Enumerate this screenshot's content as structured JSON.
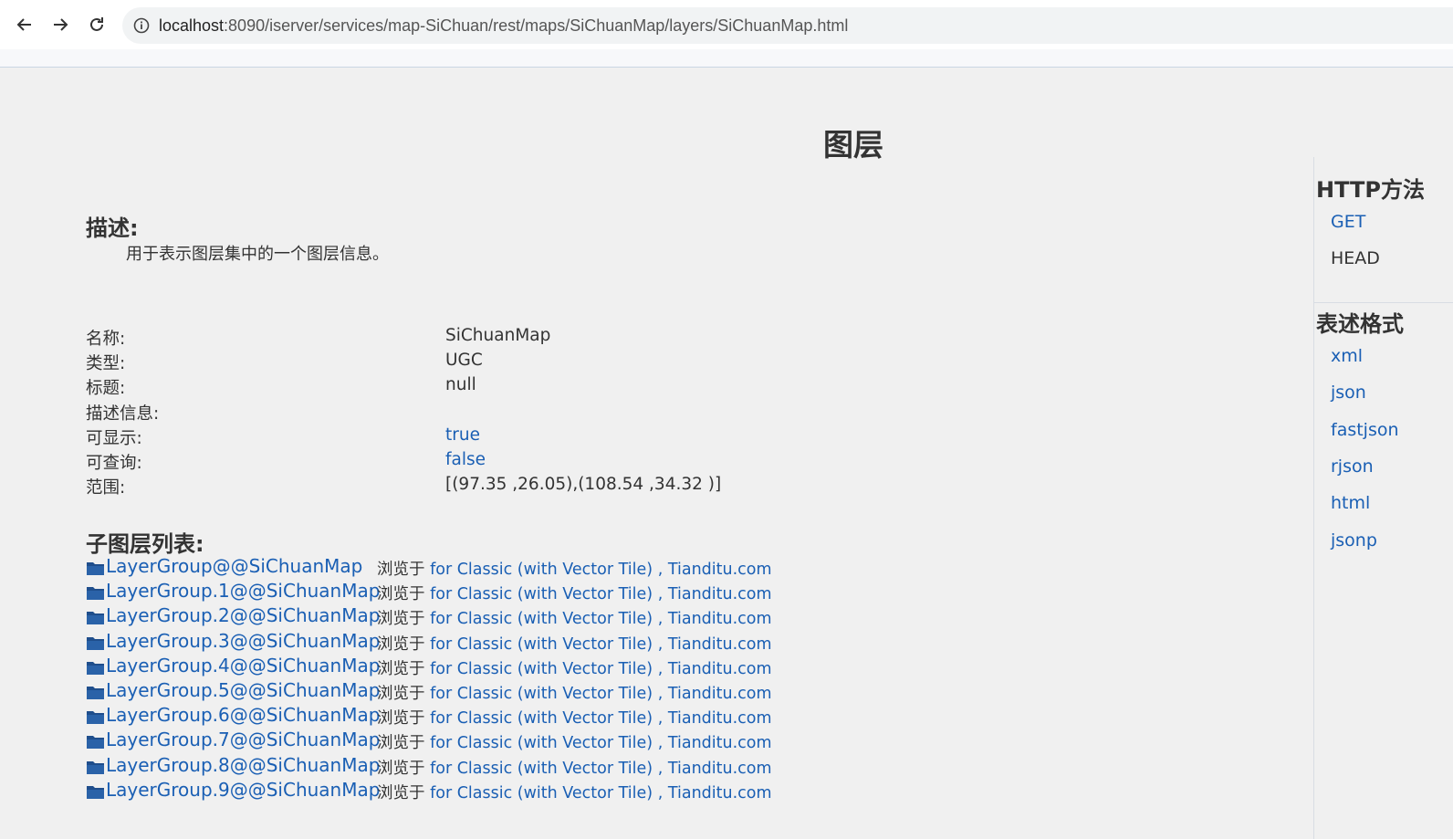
{
  "browser": {
    "url_host": "localhost",
    "url_rest": ":8090/iserver/services/map-SiChuan/rest/maps/SiChuanMap/layers/SiChuanMap.html"
  },
  "page": {
    "title": "图层",
    "description_heading": "描述:",
    "description_text": "用于表示图层集中的一个图层信息。",
    "sublayers_heading": "子图层列表:"
  },
  "properties": [
    {
      "label": "名称:",
      "value": "SiChuanMap",
      "is_link": false
    },
    {
      "label": "类型:",
      "value": "UGC",
      "is_link": false
    },
    {
      "label": "标题:",
      "value": "null",
      "is_link": false
    },
    {
      "label": "描述信息:",
      "value": "",
      "is_link": false
    },
    {
      "label": "可显示:",
      "value": "true",
      "is_link": true
    },
    {
      "label": "可查询:",
      "value": "false",
      "is_link": true
    },
    {
      "label": "范围:",
      "value": "[(97.35 ,26.05),(108.54 ,34.32 )]",
      "is_link": false
    }
  ],
  "sublayers": {
    "browse_prefix": "浏览于",
    "link_classic": "for Classic (with Vector Tile)",
    "separator": ",",
    "link_tianditu": "Tianditu.com",
    "items": [
      "LayerGroup@@SiChuanMap",
      "LayerGroup.1@@SiChuanMap",
      "LayerGroup.2@@SiChuanMap",
      "LayerGroup.3@@SiChuanMap",
      "LayerGroup.4@@SiChuanMap",
      "LayerGroup.5@@SiChuanMap",
      "LayerGroup.6@@SiChuanMap",
      "LayerGroup.7@@SiChuanMap",
      "LayerGroup.8@@SiChuanMap",
      "LayerGroup.9@@SiChuanMap"
    ]
  },
  "sidebar": {
    "http_heading": "HTTP方法",
    "http_methods": [
      {
        "label": "GET",
        "is_link": true
      },
      {
        "label": "HEAD",
        "is_link": false
      }
    ],
    "format_heading": "表述格式",
    "formats": [
      "xml",
      "json",
      "fastjson",
      "rjson",
      "html",
      "jsonp"
    ]
  },
  "colors": {
    "link": "#1a5fb4",
    "text": "#333333",
    "folder": "#1f4e8c",
    "background": "#f0f0f0"
  }
}
